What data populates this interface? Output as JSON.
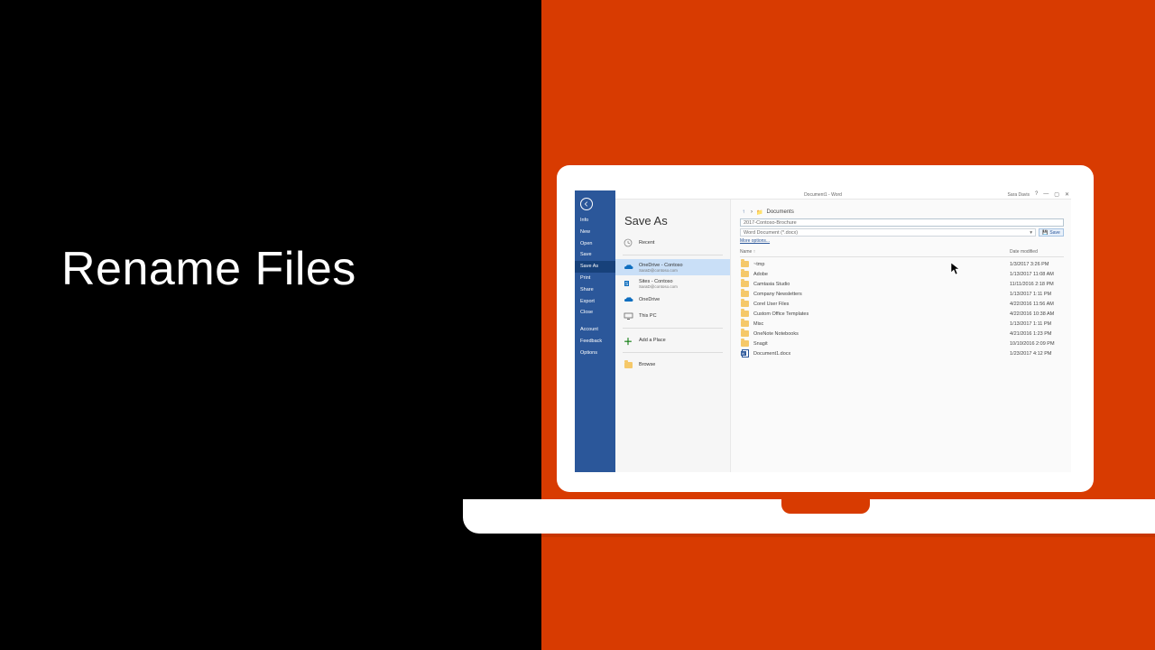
{
  "slide": {
    "title": "Rename Files"
  },
  "titlebar": {
    "doc_title": "Document1 - Word",
    "user": "Sara Davis",
    "help": "?"
  },
  "bluebar": {
    "items": [
      "Info",
      "New",
      "Open",
      "Save",
      "Save As",
      "Print",
      "Share",
      "Export",
      "Close"
    ],
    "items2": [
      "Account",
      "Feedback",
      "Options"
    ],
    "selected_index": 4
  },
  "midpane": {
    "heading": "Save As",
    "locations": [
      {
        "label": "Recent",
        "sub": "",
        "icon": "clock"
      },
      {
        "label": "OneDrive - Contoso",
        "sub": "SaraD@contoso.com",
        "icon": "onedrive",
        "selected": true
      },
      {
        "label": "Sites - Contoso",
        "sub": "SaraD@contoso.com",
        "icon": "sharepoint"
      },
      {
        "label": "OneDrive",
        "sub": "",
        "icon": "onedrive-p"
      },
      {
        "label": "This PC",
        "sub": "",
        "icon": "pc"
      },
      {
        "label": "Add a Place",
        "sub": "",
        "icon": "plus"
      },
      {
        "label": "Browse",
        "sub": "",
        "icon": "folder"
      }
    ]
  },
  "filepane": {
    "breadcrumb": "Documents",
    "filename": "2017-Contoso-Brochure",
    "format": "Word Document (*.docx)",
    "save_label": "Save",
    "more_options": "More options...",
    "col_name": "Name ↑",
    "col_date": "Date modified",
    "rows": [
      {
        "type": "folder",
        "name": "~tmp",
        "date": "1/3/2017 3:26 PM"
      },
      {
        "type": "folder",
        "name": "Adobe",
        "date": "1/13/2017 11:08 AM"
      },
      {
        "type": "folder",
        "name": "Camtasia Studio",
        "date": "11/11/2016 2:18 PM"
      },
      {
        "type": "folder",
        "name": "Company Newsletters",
        "date": "1/13/2017 1:11 PM"
      },
      {
        "type": "folder",
        "name": "Corel User Files",
        "date": "4/22/2016 11:56 AM"
      },
      {
        "type": "folder",
        "name": "Custom Office Templates",
        "date": "4/22/2016 10:38 AM"
      },
      {
        "type": "folder",
        "name": "Misc",
        "date": "1/13/2017 1:11 PM"
      },
      {
        "type": "folder",
        "name": "OneNote Notebooks",
        "date": "4/21/2016 1:23 PM"
      },
      {
        "type": "folder",
        "name": "Snagit",
        "date": "10/10/2016 2:09 PM"
      },
      {
        "type": "word",
        "name": "Document1.docx",
        "date": "1/23/2017 4:12 PM"
      }
    ]
  }
}
